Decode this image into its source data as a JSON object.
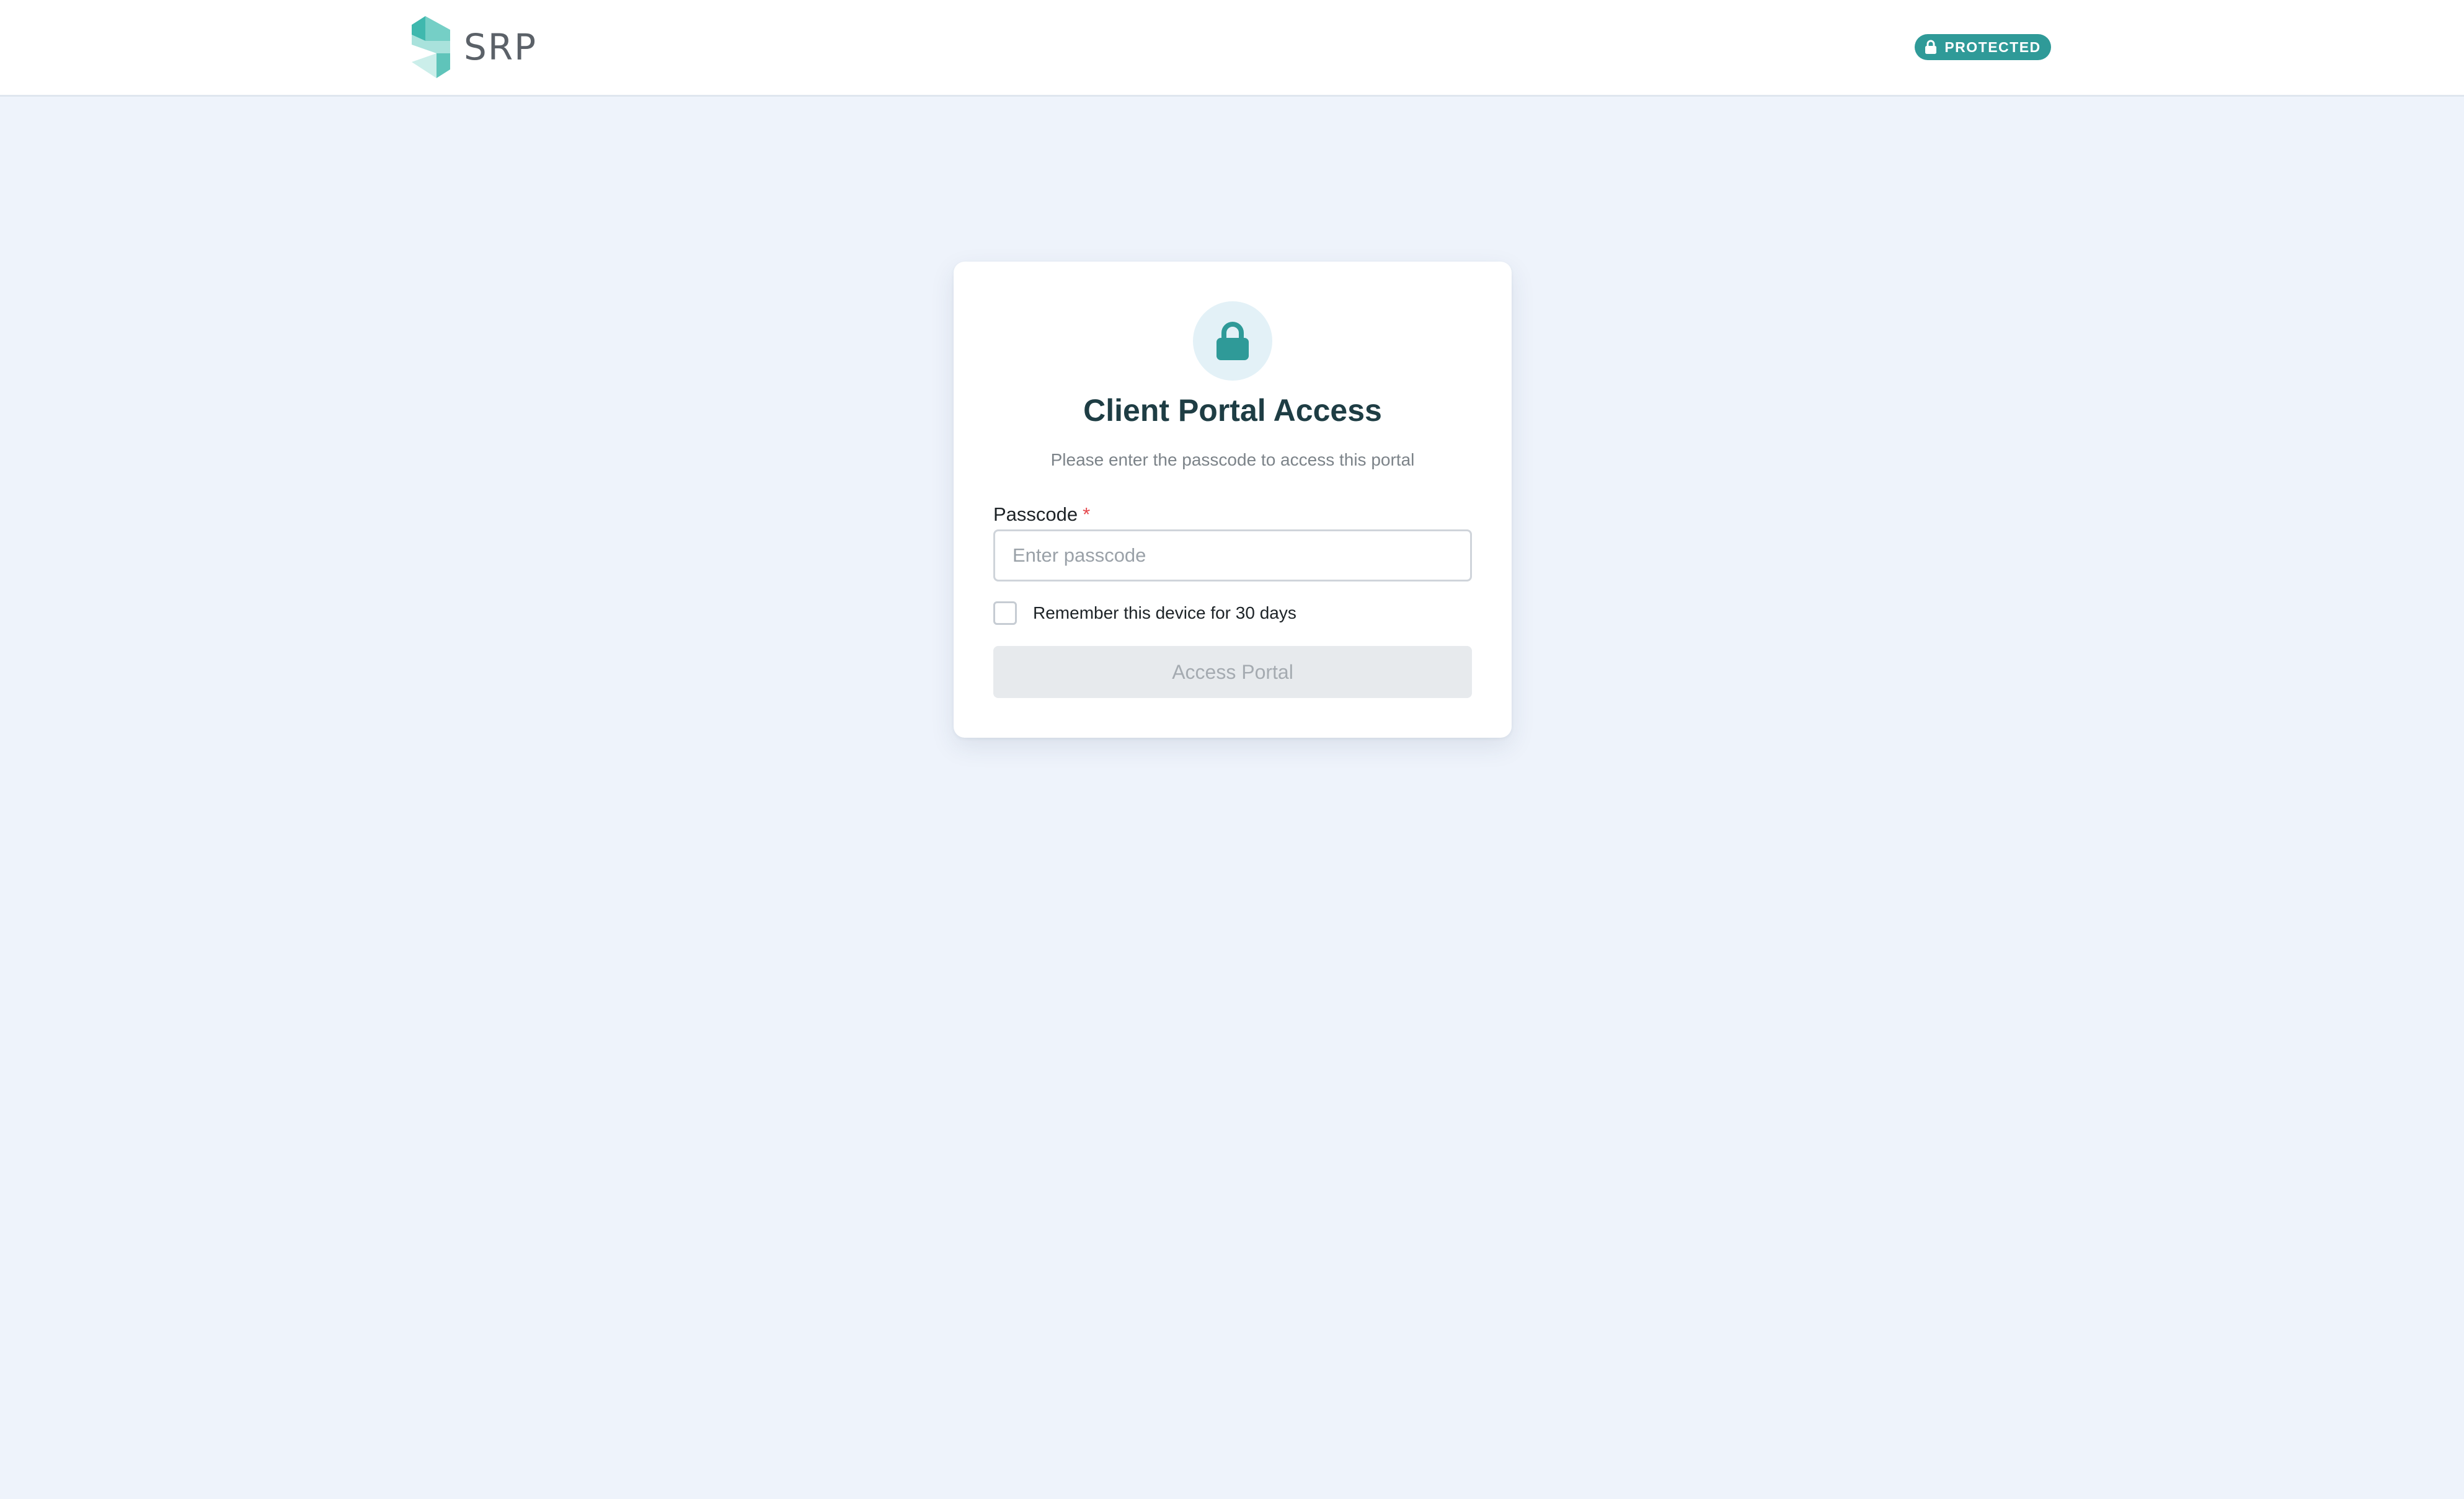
{
  "header": {
    "brand_name": "SRP",
    "badge_label": "PROTECTED",
    "brand_icon": "srp-logo-icon",
    "badge_icon": "lock-icon"
  },
  "card": {
    "icon": "lock-icon",
    "title": "Client Portal Access",
    "subtitle": "Please enter the passcode to access this portal",
    "passcode": {
      "label": "Passcode",
      "required_marker": "*",
      "placeholder": "Enter passcode",
      "value": ""
    },
    "remember": {
      "label": "Remember this device for 30 days",
      "checked": false
    },
    "submit": {
      "label": "Access Portal",
      "disabled": true
    }
  },
  "colors": {
    "accent": "#2f9a98",
    "page_background": "#eef3fb",
    "title": "#1e3d44",
    "required": "#e5484d",
    "button_disabled_bg": "#e7eaed",
    "button_disabled_text": "#a5abb1"
  }
}
